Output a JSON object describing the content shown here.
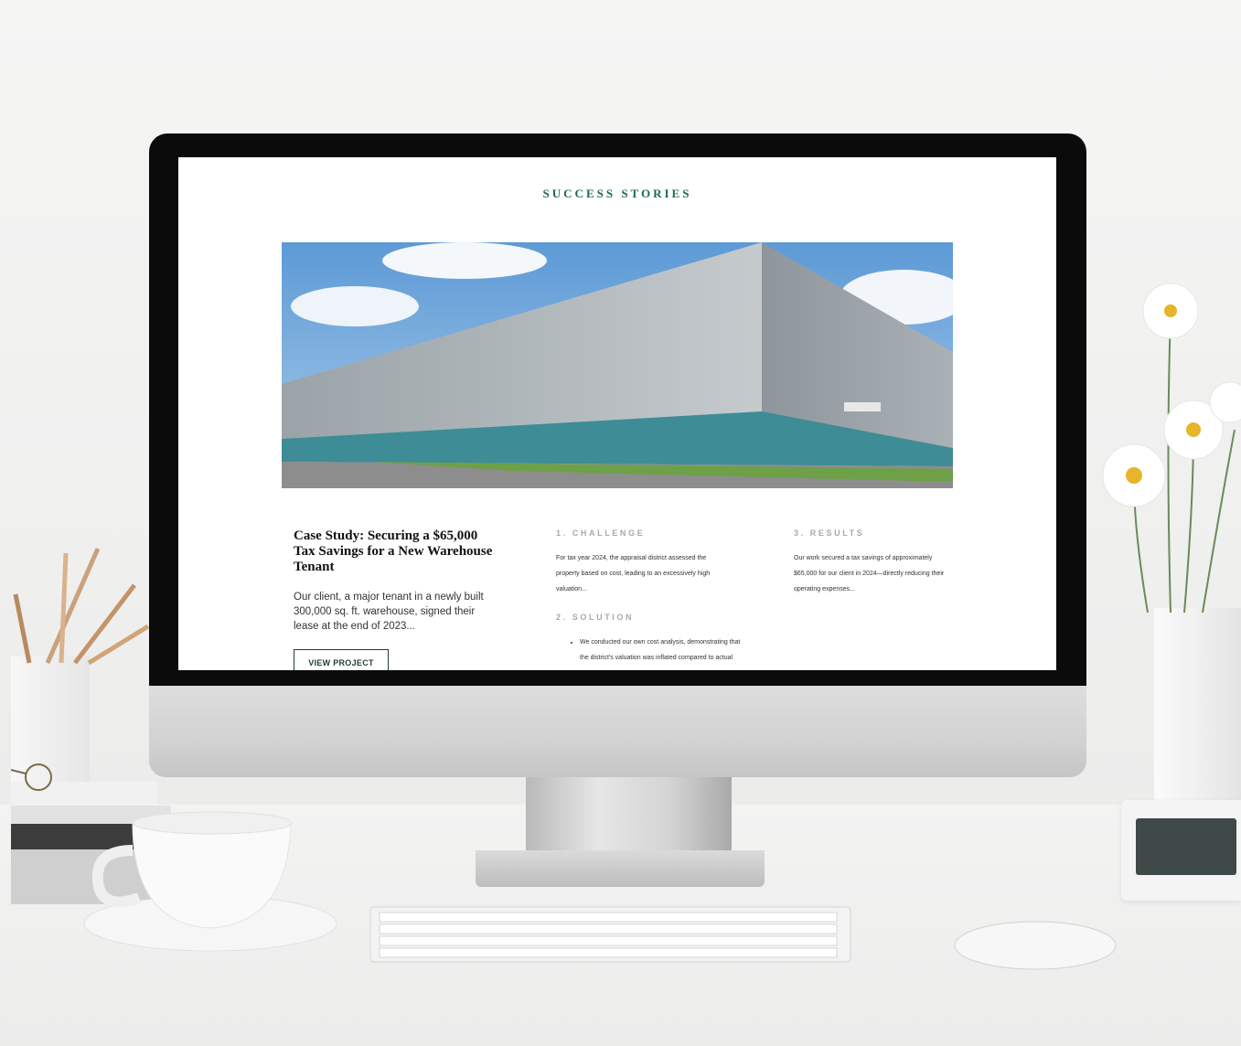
{
  "page": {
    "section_title": "SUCCESS STORIES"
  },
  "case_study": {
    "title": "Case Study: Securing a $65,000 Tax Savings for a New Warehouse Tenant",
    "excerpt": "Our client, a major tenant in a newly built 300,000 sq. ft. warehouse, signed their lease at the end of 2023...",
    "button_label": "VIEW PROJECT"
  },
  "challenge": {
    "heading": "1. CHALLENGE",
    "text": "For tax year 2024, the appraisal district assessed the property based on cost, leading to an excessively high valuation..."
  },
  "solution": {
    "heading": "2. SOLUTION",
    "bullets": [
      "We conducted our own cost analysis, demonstrating that the district's valuation was inflated compared to actual market"
    ]
  },
  "results": {
    "heading": "3. RESULTS",
    "text": "Our work secured a tax savings of approximately $65,000 for our client in 2024—directly reducing their operating expenses..."
  },
  "colors": {
    "accent": "#1f6b4c",
    "button_border": "#1f3e33",
    "muted_heading": "#a9a9a9"
  },
  "icons": {
    "bullet": "disc"
  }
}
